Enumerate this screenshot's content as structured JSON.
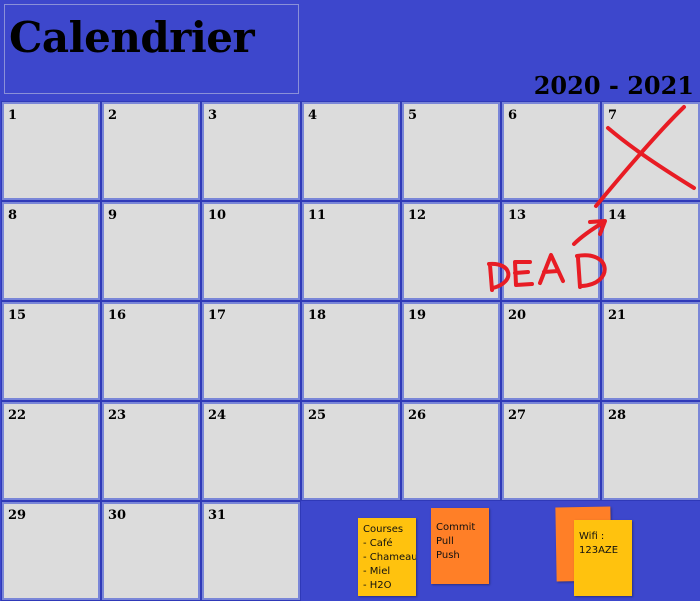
{
  "header": {
    "title": "Calendrier",
    "year_range": "2020 - 2021"
  },
  "calendar": {
    "days": [
      "1",
      "2",
      "3",
      "4",
      "5",
      "6",
      "7",
      "8",
      "9",
      "10",
      "11",
      "12",
      "13",
      "14",
      "15",
      "16",
      "17",
      "18",
      "19",
      "20",
      "21",
      "22",
      "23",
      "24",
      "25",
      "26",
      "27",
      "28",
      "29",
      "30",
      "31"
    ]
  },
  "annotations": {
    "deadline_text": "DEAD",
    "marker_color": "#e81c24"
  },
  "notes": {
    "courses": {
      "lines": [
        "Courses",
        "- Café",
        "- Chameau",
        "- Miel",
        "- H2O"
      ],
      "color": "#ffc20e"
    },
    "git": {
      "lines": [
        "Commit",
        "Pull",
        "Push"
      ],
      "color": "#ff7f27"
    },
    "wifi": {
      "lines": [
        "Wifi :",
        "123AZE"
      ],
      "color": "#ffc20e"
    },
    "blank_orange": {
      "color": "#ff7f27"
    }
  },
  "colors": {
    "background": "#3d47cc",
    "cell": "#dcdcdc"
  }
}
